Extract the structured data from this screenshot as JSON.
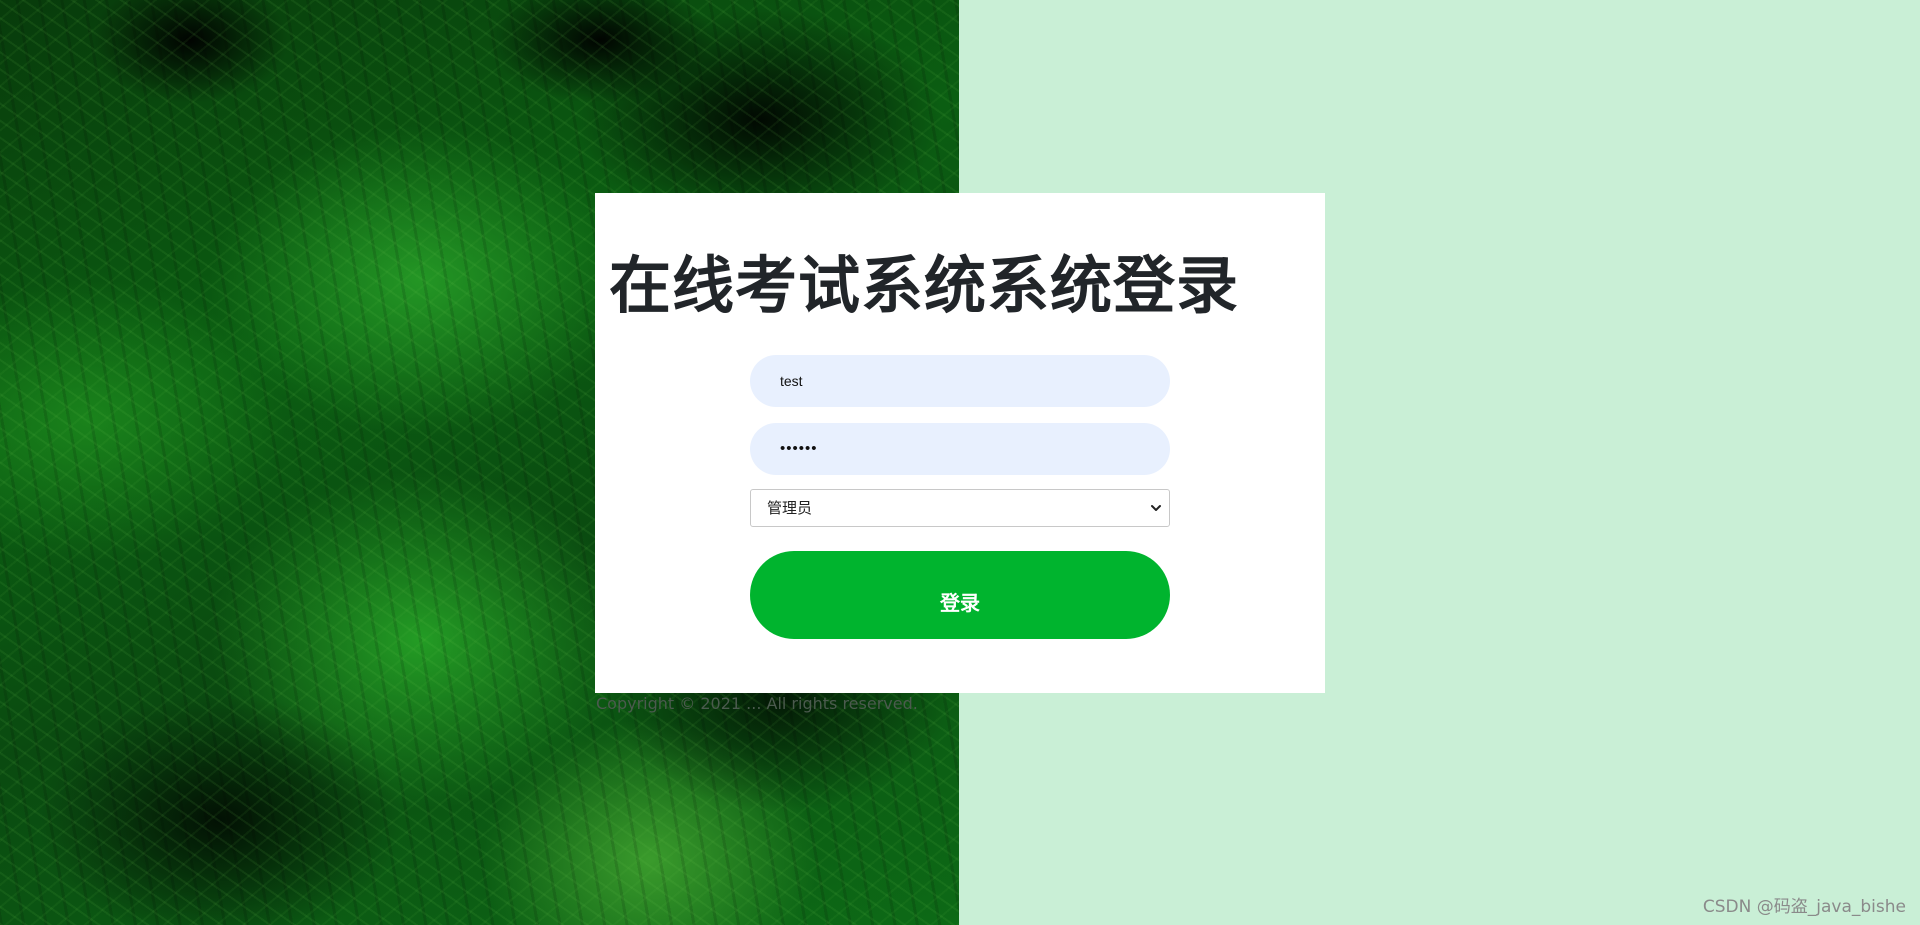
{
  "background": {
    "photo_description_icon": "fern-photo",
    "right_color": "#c9efd6"
  },
  "login": {
    "title": "在线考试系统系统登录",
    "username_value": "test",
    "password_value": "••••••",
    "role_selected": "管理员",
    "submit_label": "登录"
  },
  "footer": {
    "copyright": "Copyright © 2021 ... All rights reserved."
  },
  "watermark": "CSDN @码盗_java_bishe",
  "colors": {
    "button": "#00b42e",
    "input_bg": "#e8f0fe",
    "title": "#212529"
  }
}
